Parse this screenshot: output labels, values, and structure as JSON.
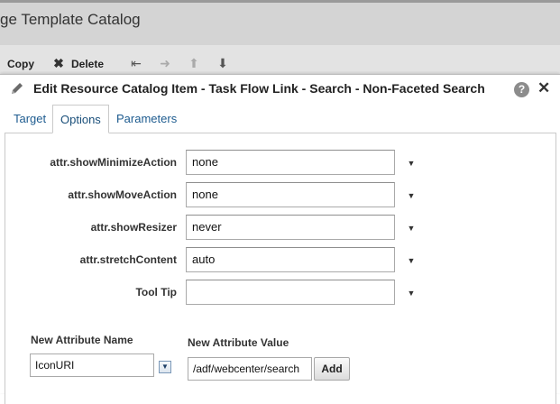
{
  "background": {
    "title": "ge Template Catalog",
    "toolbar": {
      "copy_label": "Copy",
      "delete_label": "Delete"
    }
  },
  "dialog": {
    "title": "Edit Resource Catalog Item - Task Flow Link - Search - Non-Faceted Search",
    "help_glyph": "?",
    "close_glyph": "✕",
    "tabs": [
      {
        "label": "Target",
        "active": false
      },
      {
        "label": "Options",
        "active": true
      },
      {
        "label": "Parameters",
        "active": false
      }
    ],
    "attributes": [
      {
        "label": "attr.showMinimizeAction",
        "value": "none"
      },
      {
        "label": "attr.showMoveAction",
        "value": "none"
      },
      {
        "label": "attr.showResizer",
        "value": "never"
      },
      {
        "label": "attr.stretchContent",
        "value": "auto"
      },
      {
        "label": "Tool Tip",
        "value": ""
      }
    ],
    "new_attribute": {
      "name_label": "New Attribute Name",
      "name_value": "IconURI",
      "value_label": "New Attribute Value",
      "value_value": "/adf/webcenter/search",
      "add_label": "Add"
    }
  },
  "colors": {
    "tab_link": "#1d5b8f",
    "header_bg": "#d4d4d4",
    "toolbar_bg": "#e3e3e3"
  }
}
